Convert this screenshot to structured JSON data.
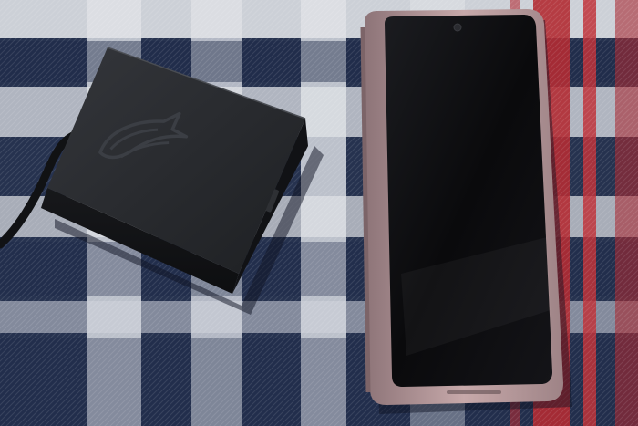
{
  "scene": {
    "objects": [
      "blanket",
      "charger",
      "charger-cable",
      "phone"
    ],
    "colors": {
      "navy": "#1f2a4a",
      "white": "#dfe1e6",
      "red": "#b32b33",
      "charger": "#24262a",
      "phone_frame": "#b89a9c",
      "screen": "#0b0b0d"
    },
    "icons": [
      "rog-logo-icon",
      "front-camera-icon"
    ]
  }
}
